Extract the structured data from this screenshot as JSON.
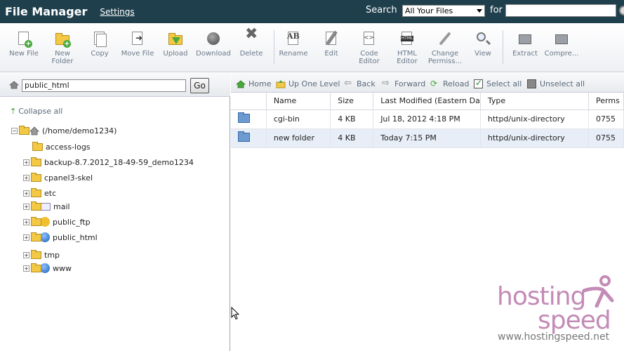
{
  "topbar": {
    "title": "File Manager",
    "settings": "Settings",
    "search_label": "Search",
    "search_scope": "All Your Files",
    "for_label": "for",
    "search_value": ""
  },
  "toolbar": {
    "items": [
      {
        "label": "New File",
        "icon": "new-file-icon"
      },
      {
        "label": "New Folder",
        "icon": "new-folder-icon"
      },
      {
        "label": "Copy",
        "icon": "copy-icon"
      },
      {
        "label": "Move File",
        "icon": "move-file-icon"
      },
      {
        "label": "Upload",
        "icon": "upload-icon"
      },
      {
        "label": "Download",
        "icon": "download-icon"
      },
      {
        "label": "Delete",
        "icon": "delete-icon"
      },
      {
        "label": "Rename",
        "icon": "rename-icon"
      },
      {
        "label": "Edit",
        "icon": "edit-icon"
      },
      {
        "label": "Code Editor",
        "icon": "code-editor-icon"
      },
      {
        "label": "HTML Editor",
        "icon": "html-editor-icon"
      },
      {
        "label": "Change Permiss...",
        "icon": "change-permissions-icon"
      },
      {
        "label": "View",
        "icon": "view-icon"
      },
      {
        "label": "Extract",
        "icon": "extract-icon"
      },
      {
        "label": "Compre...",
        "icon": "compress-icon"
      }
    ]
  },
  "left": {
    "path_value": "public_html",
    "go_label": "Go",
    "collapse_all": "Collapse all",
    "root_label": "(/home/demo1234)",
    "tree": [
      {
        "label": "access-logs",
        "expandable": false,
        "icon": "folder-icon"
      },
      {
        "label": "backup-8.7.2012_18-49-59_demo1234",
        "expandable": true,
        "icon": "folder-icon"
      },
      {
        "label": "cpanel3-skel",
        "expandable": true,
        "icon": "folder-icon"
      },
      {
        "label": "etc",
        "expandable": true,
        "icon": "folder-icon"
      },
      {
        "label": "mail",
        "expandable": true,
        "icon": "mail-icon"
      },
      {
        "label": "public_ftp",
        "expandable": true,
        "icon": "ftp-icon"
      },
      {
        "label": "public_html",
        "expandable": true,
        "icon": "globe-icon"
      },
      {
        "label": "tmp",
        "expandable": true,
        "icon": "folder-icon"
      },
      {
        "label": "www",
        "expandable": true,
        "icon": "globe-icon"
      }
    ]
  },
  "nav": {
    "home": "Home",
    "up": "Up One Level",
    "back": "Back",
    "forward": "Forward",
    "reload": "Reload",
    "select_all": "Select all",
    "unselect_all": "Unselect all"
  },
  "table": {
    "columns": [
      "",
      "Name",
      "Size",
      "Last Modified (Eastern Da",
      "Type",
      "Perms"
    ],
    "rows": [
      {
        "name": "cgi-bin",
        "size": "4 KB",
        "modified": "Jul 18, 2012 4:18 PM",
        "type": "httpd/unix-directory",
        "perms": "0755"
      },
      {
        "name": "new folder",
        "size": "4 KB",
        "modified": "Today 7:15 PM",
        "type": "httpd/unix-directory",
        "perms": "0755"
      }
    ]
  },
  "watermark": {
    "line1": "hosting",
    "line2": "speed",
    "url": "www.hostingspeed.net"
  },
  "colors": {
    "topbar": "#1f3f4c",
    "selected_row": "#e8eef7",
    "watermark": "#c38bb6"
  }
}
